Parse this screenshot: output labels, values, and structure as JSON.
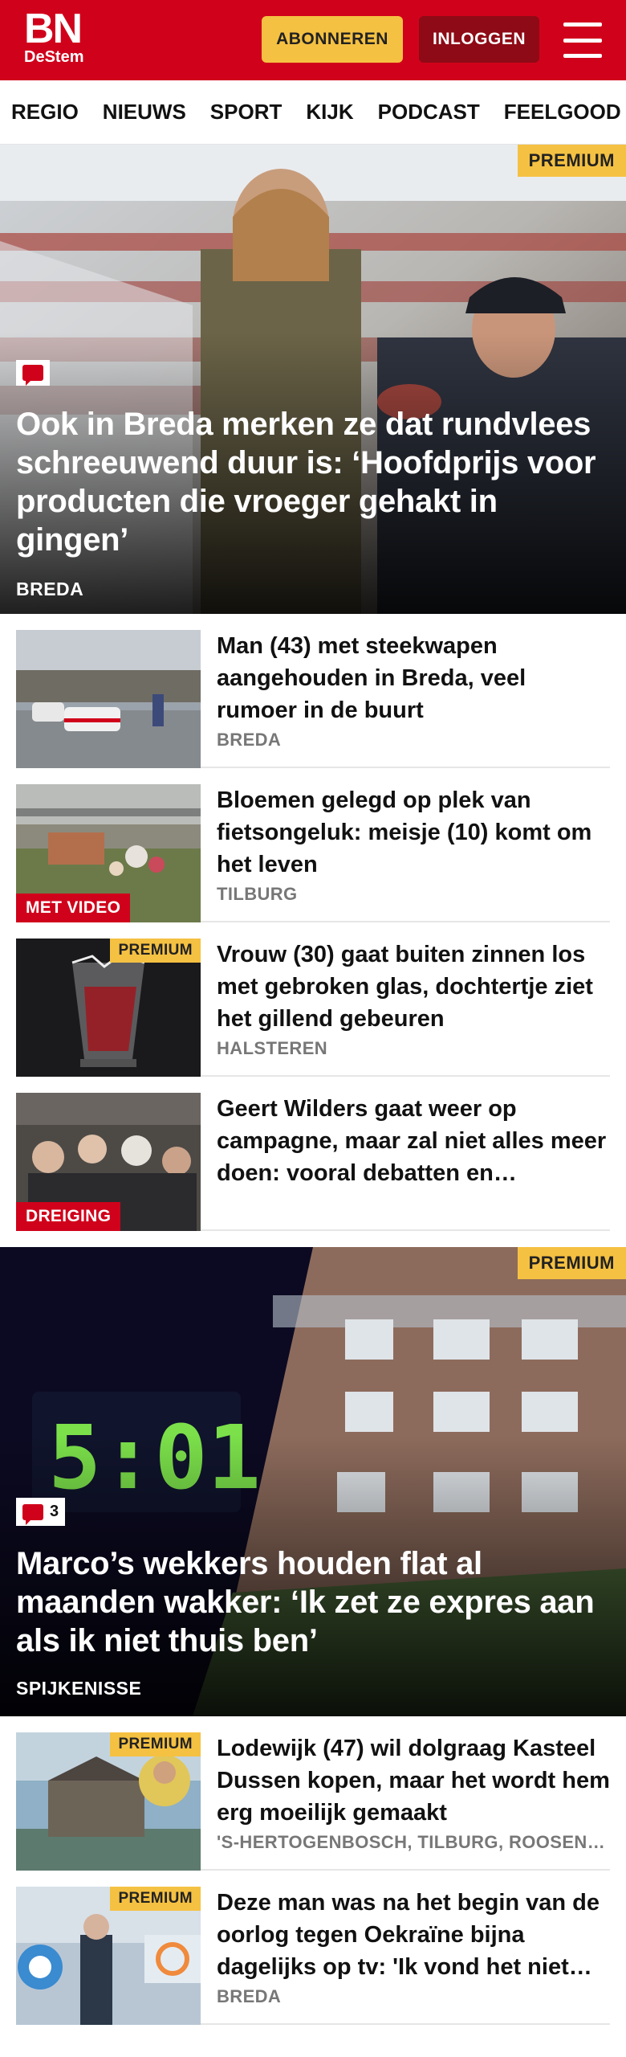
{
  "header": {
    "logo_main": "BN",
    "logo_sub": "DeStem",
    "subscribe_label": "ABONNEREN",
    "login_label": "INLOGGEN"
  },
  "nav": {
    "items": [
      "REGIO",
      "NIEUWS",
      "SPORT",
      "KIJK",
      "PODCAST",
      "FEELGOOD"
    ]
  },
  "hero1": {
    "premium": "PREMIUM",
    "title": "Ook in Breda merken ze dat rundvlees schreeuwend duur is: ‘Hoofdprijs voor producten die vroeger gehakt in gingen’",
    "location": "BREDA"
  },
  "list1": [
    {
      "title": "Man (43) met steekwapen aangehouden in Breda, veel rumoer in de buurt",
      "location": "BREDA"
    },
    {
      "title": "Bloemen gelegd op plek van fietsongeluk: meisje (10) komt om het leven",
      "location": "TILBURG",
      "label": "MET VIDEO"
    },
    {
      "title": "Vrouw (30) gaat buiten zinnen los met gebroken glas, dochtertje ziet het gillend gebeuren",
      "location": "HALSTEREN",
      "premium": "PREMIUM"
    },
    {
      "title": "Geert Wilders gaat weer op campagne, maar zal niet alles meer doen: vooral debatten en rondreizen",
      "location": "",
      "label": "DREIGING"
    }
  ],
  "hero2": {
    "premium": "PREMIUM",
    "comments": "3",
    "clock": "5:01",
    "title": "Marco’s wekkers houden flat al maanden wakker: ‘Ik zet ze expres aan als ik niet thuis ben’",
    "location": "SPIJKENISSE"
  },
  "list2": [
    {
      "title": "Lodewijk (47) wil dolgraag Kasteel Dussen kopen, maar het wordt hem erg moeilijk gemaakt",
      "location": "'S-HERTOGENBOSCH, TILBURG, ROOSENDAAL",
      "premium": "PREMIUM"
    },
    {
      "title": "Deze man was na het begin van de oorlog tegen Oekraïne bijna dagelijks op tv: 'Ik vond het niet erg'",
      "location": "BREDA",
      "premium": "PREMIUM"
    }
  ],
  "colors": {
    "brand_red": "#d0021b",
    "premium_yellow": "#f5c142",
    "login_dark_red": "#8e0a16"
  }
}
